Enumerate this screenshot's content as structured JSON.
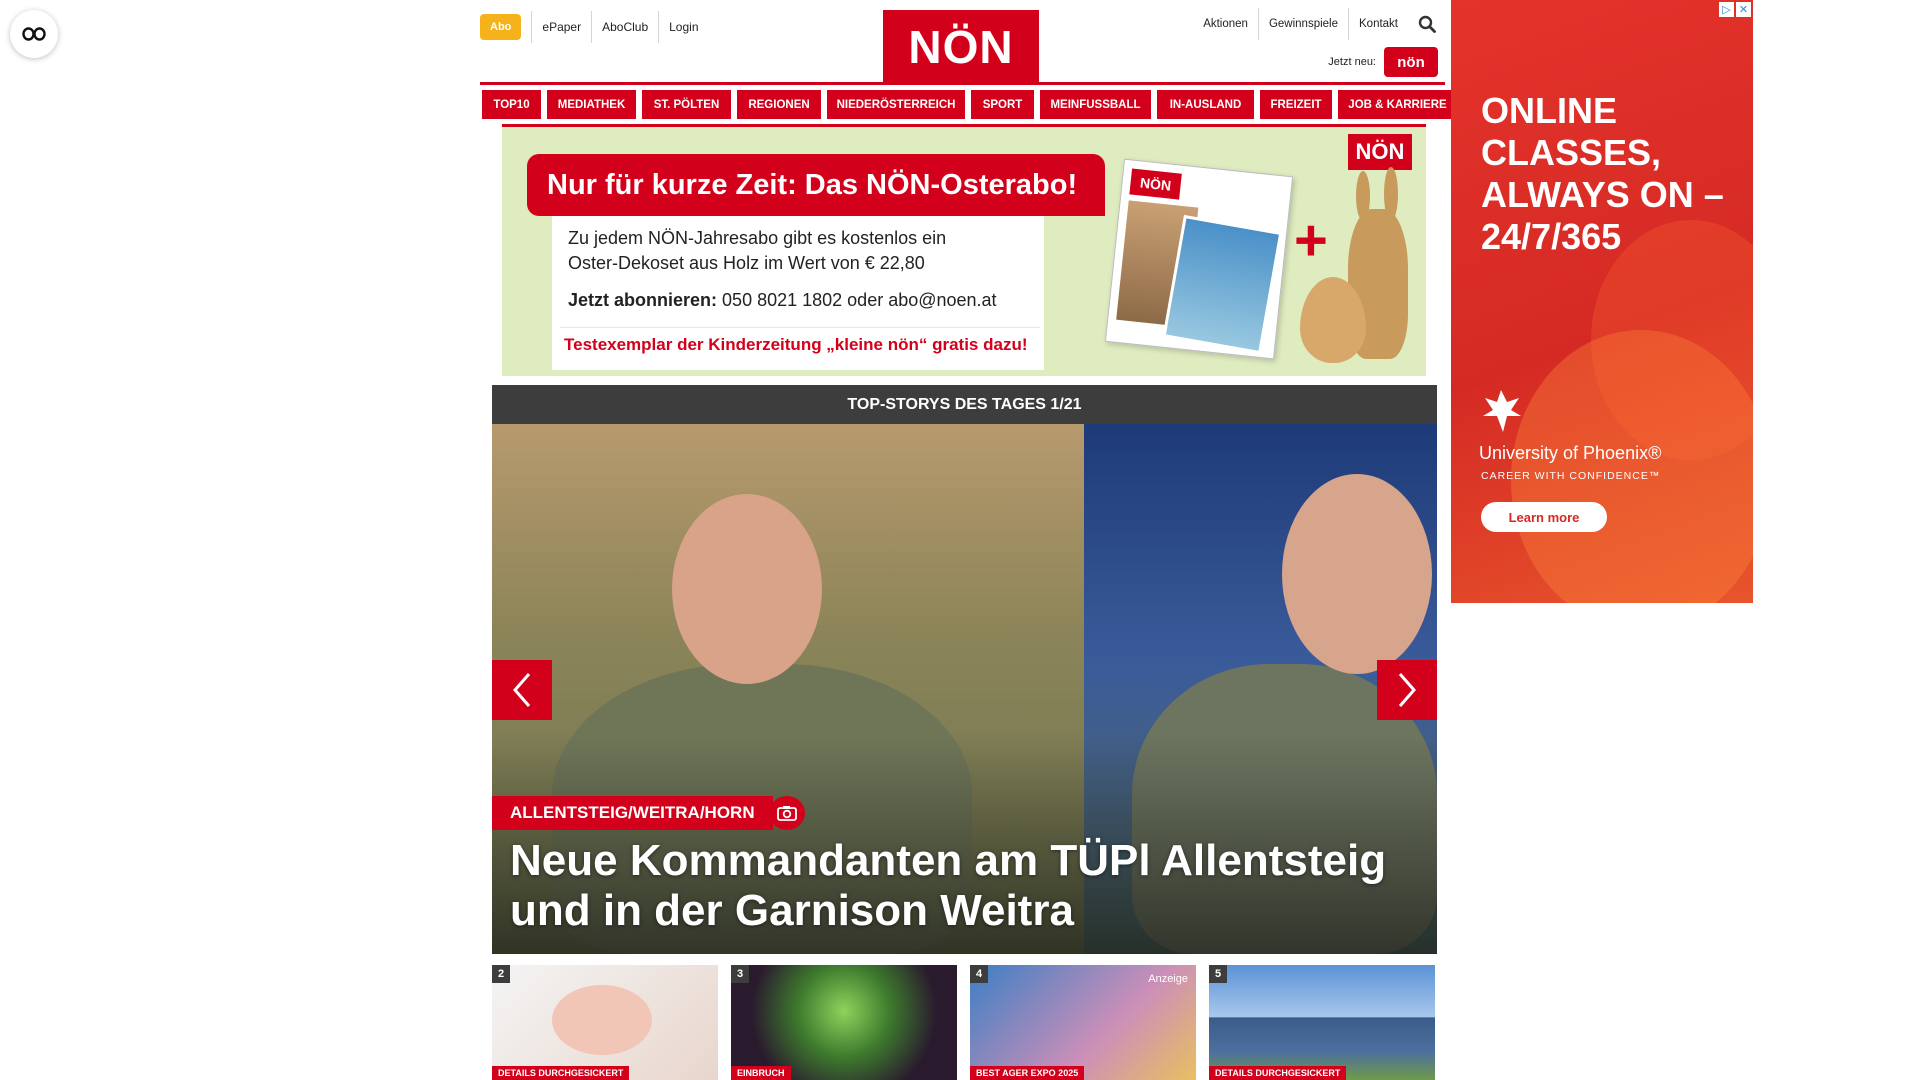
{
  "a11y": {
    "icon": "accessibility-icon"
  },
  "header": {
    "abo_label": "Abo",
    "top_links": [
      "ePaper",
      "AboClub",
      "Login"
    ],
    "logo_text": "NÖN",
    "right_links": [
      "Aktionen",
      "Gewinnspiele",
      "Kontakt"
    ],
    "search_icon": "search-icon",
    "jetzt_neu_label": "Jetzt neu:",
    "kleine_non_badge": "nön"
  },
  "nav": {
    "items": [
      "TOP10",
      "MEDIATHEK",
      "ST. PÖLTEN",
      "REGIONEN",
      "NIEDERÖSTERREICH",
      "SPORT",
      "MEINFUSSBALL",
      "IN-AUSLAND",
      "FREIZEIT",
      "JOB & KARRIERE"
    ]
  },
  "promo": {
    "title": "Nur für kurze Zeit: Das NÖN-Osterabo!",
    "description": "Zu jedem NÖN-Jahresabo gibt es kostenlos ein Oster-Dekoset aus Holz im Wert von € 22,80",
    "cta_label": "Jetzt abonnieren:",
    "cta_contact": "050 8021 1802 oder abo@noen.at",
    "bottom_text": "Testexemplar der Kinderzeitung „kleine nön“ gratis dazu!",
    "logo": "NÖN",
    "magazine_label": "NÖN"
  },
  "top_stories": {
    "header": "TOP-STORYS DES TAGES 1/21",
    "tag": "ALLENTSTEIG/WEITRA/HORN",
    "headline": "Neue Kommandanten am TÜPl Allentsteig und in der Garnison Weitra",
    "prev_icon": "chevron-left-icon",
    "next_icon": "chevron-right-icon",
    "camera_icon": "camera-icon"
  },
  "teasers": [
    {
      "number": "2",
      "tag": "DETAILS DURCHGESICKERT",
      "sponsored": ""
    },
    {
      "number": "3",
      "tag": "EINBRUCH",
      "sponsored": ""
    },
    {
      "number": "4",
      "tag": "BEST AGER EXPO 2025",
      "sponsored": "Anzeige"
    },
    {
      "number": "5",
      "tag": "DETAILS DURCHGESICKERT",
      "sponsored": ""
    }
  ],
  "ad": {
    "headline": "ONLINE CLASSES, ALWAYS ON – 24/7/365",
    "brand": "University of Phoenix®",
    "tagline": "CAREER WITH CONFIDENCE™",
    "cta": "Learn more",
    "adchoices_icon": "▷",
    "close_icon": "✕"
  },
  "colors": {
    "brand_red": "#d3001b",
    "abo_yellow": "#f5b21b",
    "dark_header": "#3d3d3d",
    "promo_green": "#dfecc0",
    "ad_red": "#e4332b"
  }
}
